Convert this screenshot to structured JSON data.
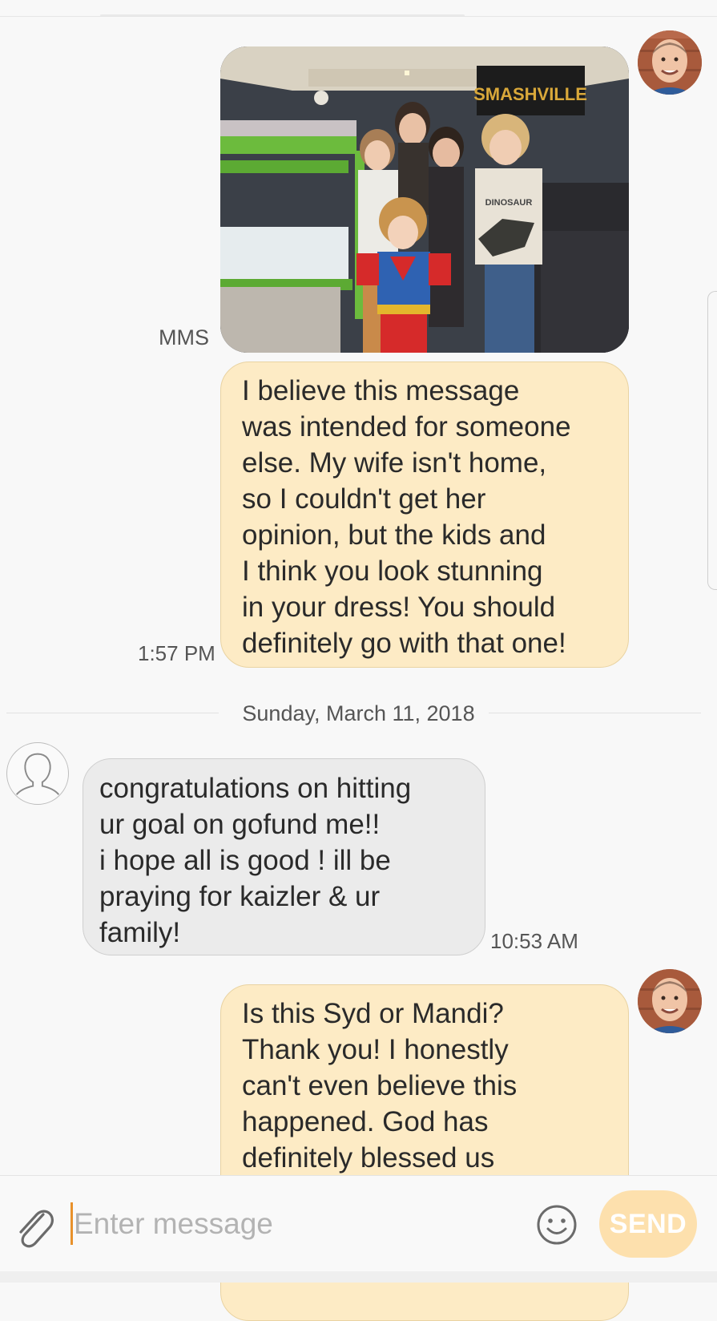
{
  "conversation": {
    "messages": [
      {
        "direction": "outgoing",
        "type": "mms",
        "label": "MMS",
        "image_text": "SMASHVILLE",
        "shirt_text": "DINOSAUR"
      },
      {
        "direction": "outgoing",
        "text": "I believe this message\nwas intended for someone\nelse. My wife isn't home,\nso I couldn't get her\nopinion, but the kids and\nI think you look stunning\nin your dress! You should\ndefinitely go with that one!",
        "time": "1:57 PM"
      },
      {
        "date_separator": "Sunday, March 11, 2018"
      },
      {
        "direction": "incoming",
        "text": "congratulations on hitting\nur goal on gofund me!!\ni hope all is good ! ill be\npraying for kaizler & ur\nfamily!",
        "time": "10:53 AM"
      },
      {
        "direction": "outgoing",
        "text": "Is this Syd or Mandi?\nThank you! I honestly\ncan't even believe this\nhappened. God has\ndefinitely blessed us"
      }
    ]
  },
  "composer": {
    "placeholder": "Enter message",
    "send_label": "SEND",
    "attach_icon": "paperclip-icon",
    "emoji_icon": "smiley-icon"
  },
  "colors": {
    "outgoing_bubble": "#fdebc5",
    "incoming_bubble": "#ebebeb",
    "send_button": "#fde0ad",
    "cursor": "#e8912b"
  }
}
